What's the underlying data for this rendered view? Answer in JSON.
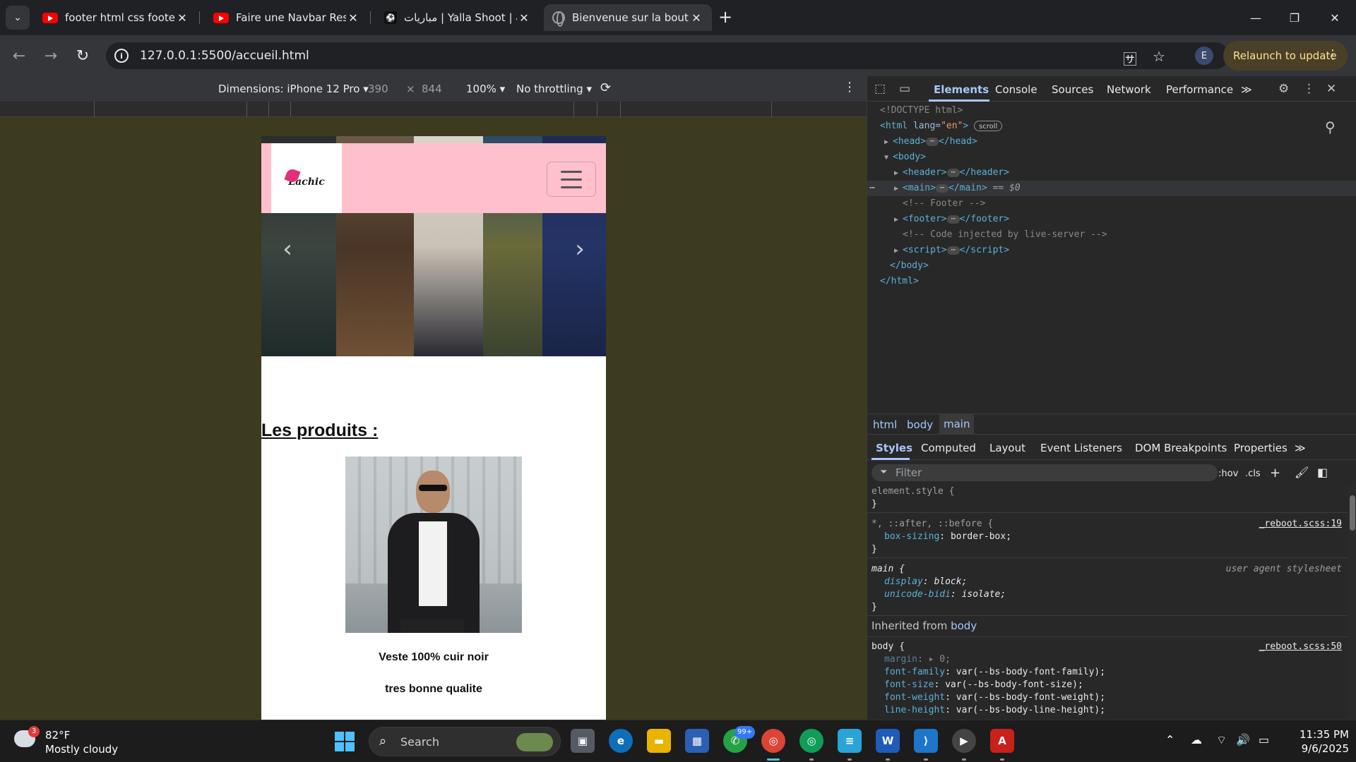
{
  "tabs": [
    {
      "title": "footer html css footer design in",
      "icon": "youtube-icon"
    },
    {
      "title": "Faire une Navbar Responsive en",
      "icon": "youtube-icon"
    },
    {
      "title": "مباريات | Yalla Shoot | يلا شوت",
      "icon": "yallashoot-icon"
    },
    {
      "title": "Bienvenue sur la boutique",
      "icon": "globe-icon",
      "active": true
    }
  ],
  "toolbar": {
    "url": "127.0.0.1:5500/accueil.html",
    "profile_initial": "E",
    "relaunch_label": "Relaunch to update"
  },
  "device_toolbar": {
    "dimensions_label": "Dimensions: iPhone 12 Pro",
    "width": "390",
    "times": "×",
    "height": "844",
    "zoom": "100%",
    "throttling": "No throttling"
  },
  "page": {
    "products_title": "Les produits :",
    "product_name": "Veste 100% cuir noir",
    "product_desc": "tres bonne qualite",
    "logo_text": "Lachic",
    "header_bg": "#ffc0cb"
  },
  "devtools": {
    "tabs": [
      "Elements",
      "Console",
      "Sources",
      "Network",
      "Performance"
    ],
    "more": "≫",
    "dom": {
      "doctype": "<!DOCTYPE html>",
      "html_open_tag": "html",
      "html_attr": "lang",
      "html_attr_val": "\"en\"",
      "scroll_badge": "scroll",
      "head": "head",
      "body": "body",
      "header": "header",
      "main": "main",
      "sel_marker": "== $0",
      "footer_comment": "<!-- Footer -->",
      "footer": "footer",
      "ls_comment": "<!-- Code injected by live-server -->",
      "script": "script",
      "body_close": "</body>",
      "html_close": "</html>",
      "ellipsis": "⋯"
    },
    "breadcrumbs": [
      "html",
      "body",
      "main"
    ],
    "style_tabs": [
      "Styles",
      "Computed",
      "Layout",
      "Event Listeners",
      "DOM Breakpoints",
      "Properties"
    ],
    "filter_placeholder": "Filter",
    "filter_tools": [
      ":hov",
      ".cls"
    ],
    "styles": {
      "element_style": "element.style {",
      "close": "}",
      "universal_selector": "*, ::after, ::before {",
      "universal_src": "_reboot.scss:19",
      "box_sizing_prop": "box-sizing",
      "box_sizing_val": "border-box;",
      "main_selector": "main {",
      "main_src": "user agent stylesheet",
      "display_prop": "display",
      "display_val": "block;",
      "unicode_prop": "unicode-bidi",
      "unicode_val": "isolate;",
      "inherited_label": "Inherited from",
      "inherited_from": "body",
      "body_selector": "body {",
      "body_src": "_reboot.scss:50",
      "margin_prop": "margin",
      "margin_val": "0;",
      "ff_prop": "font-family",
      "ff_val": "var(--bs-body-font-family);",
      "fs_prop": "font-size",
      "fs_val": "var(--bs-body-font-size);",
      "fw_prop": "font-weight",
      "fw_val": "var(--bs-body-font-weight);",
      "lh_prop": "line-height",
      "lh_val": "var(--bs-body-line-height);"
    }
  },
  "taskbar": {
    "weather_badge": "3",
    "temperature": "82°F",
    "condition": "Mostly cloudy",
    "search_label": "Search",
    "whatsapp_badge": "99+",
    "time": "11:35 PM",
    "date": "9/6/2025"
  },
  "colors": {
    "accent_blue": "#a8c7fa",
    "relaunch_bg": "#4a4028",
    "device_bg": "#3c3a1f"
  }
}
